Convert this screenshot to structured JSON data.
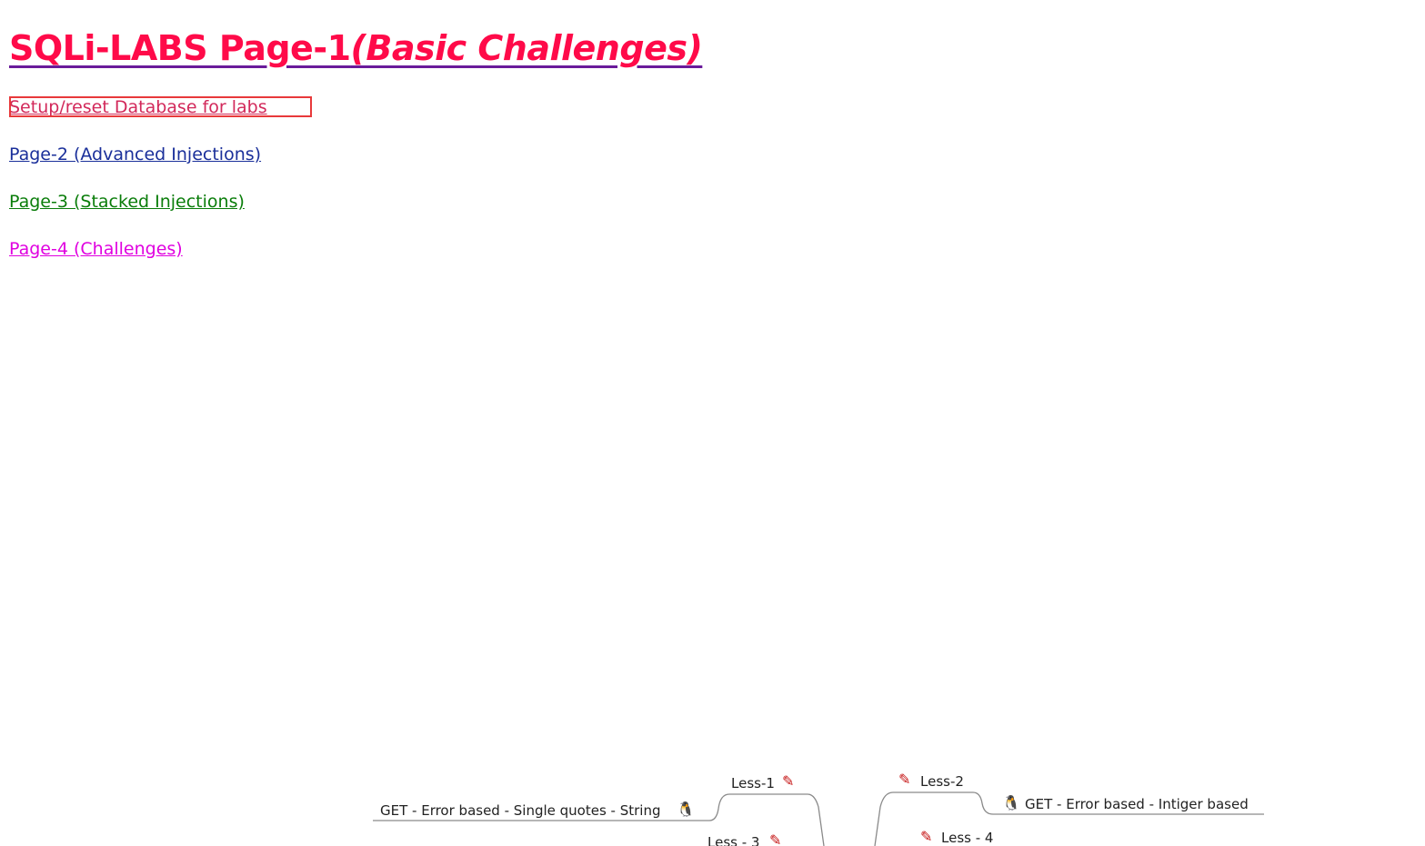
{
  "page": {
    "title_main": "SQLi-LABS Page-1",
    "title_sub": "(Basic Challenges)"
  },
  "links": {
    "setup": "Setup/reset Database for labs",
    "page2": "Page-2 (Advanced Injections)",
    "page3": "Page-3 (Stacked Injections)",
    "page4": "Page-4 (Challenges)"
  },
  "colors": {
    "title": "#ff0a49",
    "setup_link": "#d2285a",
    "page2_link": "#1a2f9a",
    "page3_link": "#0a7d0a",
    "page4_link": "#e000e0",
    "focus_outline": "#e8393b"
  },
  "mindmap": {
    "less1": "Less-1",
    "less1_desc": "GET - Error based - Single quotes - String",
    "less2": "Less-2",
    "less2_desc": "GET - Error based - Intiger based",
    "less3": "Less - 3",
    "less4": "Less - 4",
    "icons": [
      "pencil-icon",
      "penguin-icon"
    ]
  }
}
